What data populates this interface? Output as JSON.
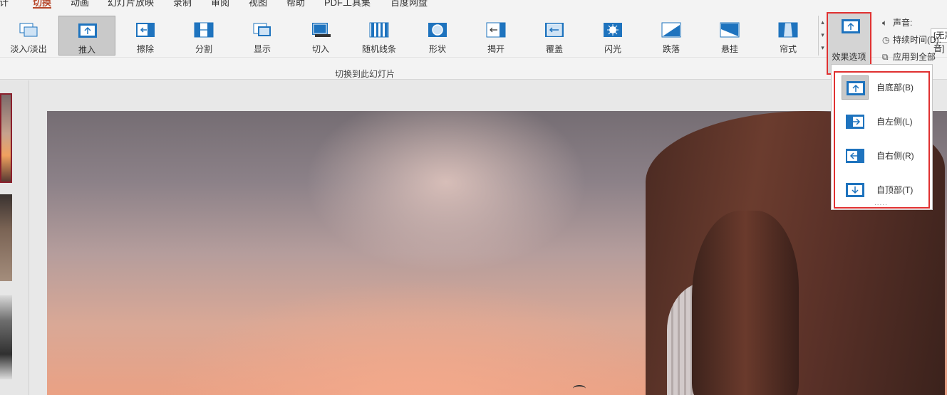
{
  "menu": {
    "tabs": [
      {
        "label": "设计"
      },
      {
        "label": "切换"
      },
      {
        "label": "动画"
      },
      {
        "label": "幻灯片放映"
      },
      {
        "label": "录制"
      },
      {
        "label": "审阅"
      },
      {
        "label": "视图"
      },
      {
        "label": "帮助"
      },
      {
        "label": "PDF工具集"
      },
      {
        "label": "百度网盘"
      }
    ],
    "active": "切换"
  },
  "ribbon": {
    "transitions": [
      {
        "label": "淡入/淡出",
        "icon": "fade-icon"
      },
      {
        "label": "推入",
        "icon": "push-icon",
        "selected": true
      },
      {
        "label": "擦除",
        "icon": "wipe-icon"
      },
      {
        "label": "分割",
        "icon": "split-icon"
      },
      {
        "label": "显示",
        "icon": "reveal-icon"
      },
      {
        "label": "切入",
        "icon": "cut-icon"
      },
      {
        "label": "随机线条",
        "icon": "random-bars-icon"
      },
      {
        "label": "形状",
        "icon": "shape-icon"
      },
      {
        "label": "揭开",
        "icon": "uncover-icon"
      },
      {
        "label": "覆盖",
        "icon": "cover-icon"
      },
      {
        "label": "闪光",
        "icon": "flash-icon"
      },
      {
        "label": "跌落",
        "icon": "fall-over-icon"
      },
      {
        "label": "悬挂",
        "icon": "drape-icon"
      },
      {
        "label": "帘式",
        "icon": "curtains-icon"
      }
    ],
    "group_label": "切换到此幻灯片",
    "effect_options": {
      "label": "效果选项",
      "chevron": "⌄"
    },
    "sound_label": "声音:",
    "sound_value": "[无声音]",
    "duration_label": "持续时间(D):",
    "apply_all_label": "应用到全部"
  },
  "effect_dropdown": {
    "items": [
      {
        "label": "自底部(B)",
        "icon": "from-bottom-icon",
        "selected": true
      },
      {
        "label": "自左侧(L)",
        "icon": "from-left-icon"
      },
      {
        "label": "自右侧(R)",
        "icon": "from-right-icon"
      },
      {
        "label": "自顶部(T)",
        "icon": "from-top-icon"
      }
    ],
    "more": "....."
  },
  "colors": {
    "accent": "#b7472a",
    "highlight_box": "#e03131",
    "icon_blue": "#1e73be"
  }
}
